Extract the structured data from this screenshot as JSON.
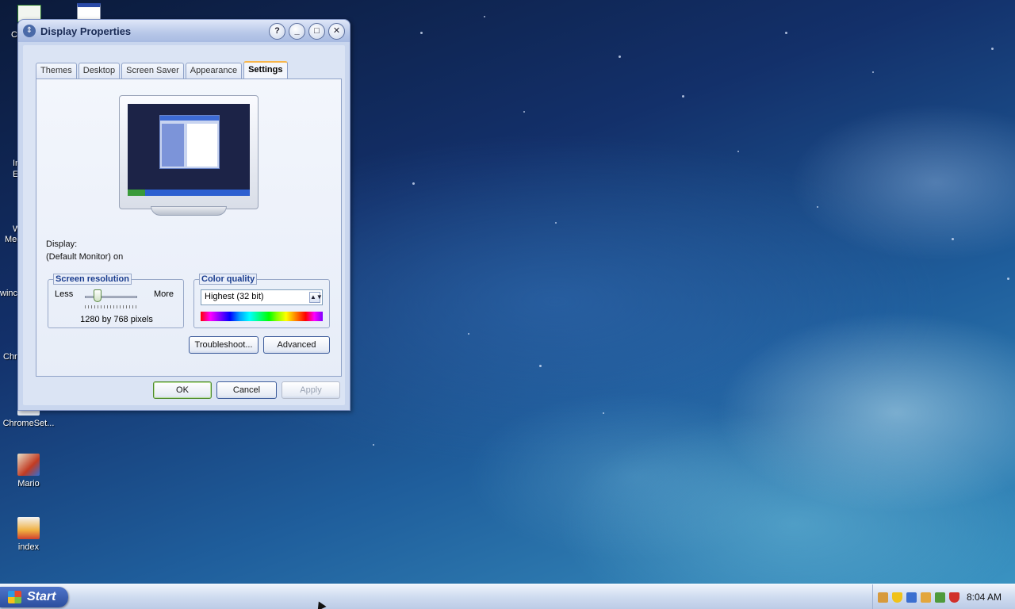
{
  "desktop": {
    "icons": [
      {
        "label": "Mario",
        "icon": "mario-shortcut-icon"
      },
      {
        "label": "index",
        "icon": "html-file-icon"
      },
      {
        "label": "ChromeSet...",
        "icon": "chrome-setup-icon"
      }
    ],
    "partial_labels": [
      "Co",
      "In",
      "E",
      "W",
      "Med",
      "winc",
      "Chr"
    ]
  },
  "window": {
    "title": "Display Properties",
    "title_icon": "display-properties-icon",
    "controls": {
      "help": "?",
      "minimize": "_",
      "maximize": "□",
      "close": "✕"
    },
    "tabs": [
      {
        "label": "Themes",
        "active": false
      },
      {
        "label": "Desktop",
        "active": false
      },
      {
        "label": "Screen Saver",
        "active": false
      },
      {
        "label": "Appearance",
        "active": false
      },
      {
        "label": "Settings",
        "active": true
      }
    ],
    "display_label": "Display:",
    "display_value": "(Default Monitor) on",
    "screen_resolution": {
      "title": "Screen resolution",
      "less": "Less",
      "more": "More",
      "value": "1280 by 768 pixels",
      "slider_level": 0.2
    },
    "color_quality": {
      "title": "Color quality",
      "selected": "Highest (32 bit)"
    },
    "buttons": {
      "troubleshoot": "Troubleshoot...",
      "advanced": "Advanced",
      "ok": "OK",
      "cancel": "Cancel",
      "apply": "Apply"
    }
  },
  "taskbar": {
    "start_label": "Start",
    "clock": "8:04 AM",
    "tray_icons": [
      "network-icon",
      "security-shield-icon",
      "bluetooth-icon",
      "update-icon",
      "volume-icon",
      "antivirus-icon"
    ]
  },
  "colors": {
    "tab_active_accent": "#f7b64b",
    "group_title": "#1a3d8f",
    "start_button": "#2c4e9e"
  }
}
